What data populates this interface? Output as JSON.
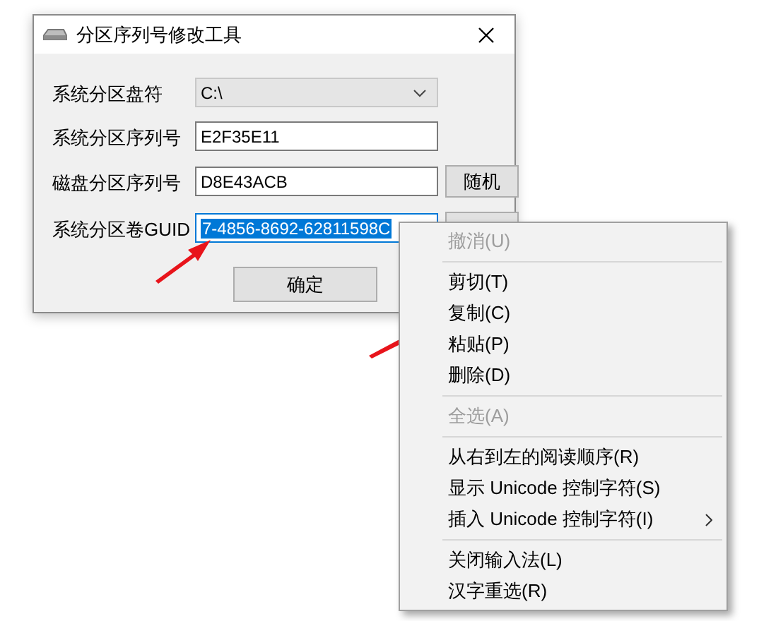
{
  "window": {
    "title": "分区序列号修改工具"
  },
  "fields": [
    {
      "kind": "combo",
      "label": "系统分区盘符",
      "value": "C:\\",
      "selected": false,
      "has_button": false
    },
    {
      "kind": "text",
      "label": "系统分区序列号",
      "value": "E2F35E11",
      "selected": false,
      "has_button": false
    },
    {
      "kind": "text",
      "label": "磁盘分区序列号",
      "value": "D8E43ACB",
      "selected": false,
      "has_button": true,
      "button": "随机"
    },
    {
      "kind": "text",
      "label": "系统分区卷GUID",
      "value": "7-4856-8692-62811598C",
      "selected": true,
      "has_button": true
    }
  ],
  "ok_button": "确定",
  "context_menu": {
    "items": [
      {
        "kind": "item",
        "label": "撤消(U)",
        "disabled": true,
        "submenu": false
      },
      {
        "kind": "separator"
      },
      {
        "kind": "item",
        "label": "剪切(T)",
        "disabled": false,
        "submenu": false
      },
      {
        "kind": "item",
        "label": "复制(C)",
        "disabled": false,
        "submenu": false
      },
      {
        "kind": "item",
        "label": "粘贴(P)",
        "disabled": false,
        "submenu": false
      },
      {
        "kind": "item",
        "label": "删除(D)",
        "disabled": false,
        "submenu": false
      },
      {
        "kind": "separator"
      },
      {
        "kind": "item",
        "label": "全选(A)",
        "disabled": true,
        "submenu": false
      },
      {
        "kind": "separator"
      },
      {
        "kind": "item",
        "label": "从右到左的阅读顺序(R)",
        "disabled": false,
        "submenu": false
      },
      {
        "kind": "item",
        "label": "显示 Unicode 控制字符(S)",
        "disabled": false,
        "submenu": false
      },
      {
        "kind": "item",
        "label": "插入 Unicode 控制字符(I)",
        "disabled": false,
        "submenu": true
      },
      {
        "kind": "separator"
      },
      {
        "kind": "item",
        "label": "关闭输入法(L)",
        "disabled": false,
        "submenu": false
      },
      {
        "kind": "item",
        "label": "汉字重选(R)",
        "disabled": false,
        "submenu": false
      }
    ]
  }
}
